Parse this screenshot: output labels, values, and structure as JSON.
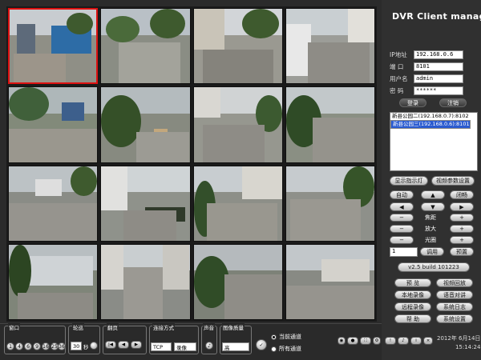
{
  "app": {
    "title": "DVR Client manager"
  },
  "login": {
    "ip_label": "IP地址",
    "ip_value": "192.168.0.6",
    "port_label": "端 口",
    "port_value": "8101",
    "user_label": "用户名",
    "user_value": "admin",
    "pass_label": "密 码",
    "pass_value": "******",
    "login_btn": "登录",
    "logout_btn": "注销"
  },
  "devices": [
    {
      "label": "新县公园二(192.168.0.7):8102",
      "selected": false
    },
    {
      "label": "新县公园三(192.168.0.6):8101",
      "selected": true
    }
  ],
  "buttons": {
    "show_osd": "显示指示灯",
    "video_params": "视频参数设置",
    "auto": "自动",
    "stop": "闭畅",
    "focus": "焦距",
    "zoom": "放大",
    "iris": "光圈",
    "call_preset": "调用",
    "set_preset": "预置",
    "preview": "预  览",
    "playback": "视频回放",
    "local_record": "本地录像",
    "voice_talk": "语音对讲",
    "remote_record": "远程录像",
    "system_log": "系统日志",
    "help": "帮  助",
    "system_settings": "系统设置"
  },
  "version": "v2.5 build 101223",
  "datetime": {
    "date": "2012年 6月14日",
    "time": "15:14:24"
  },
  "bottom": {
    "window_label": "窗口",
    "window_options": [
      "1",
      "4",
      "6",
      "9",
      "16",
      "25",
      "36"
    ],
    "poll_label": "轮巡",
    "poll_value": "30",
    "poll_unit": "秒",
    "page_label": "翻页",
    "conn_label": "连接方式",
    "conn_value": "TCP",
    "record_value": "录像",
    "sound_label": "声音",
    "quality_label": "图像质量",
    "quality_value": "高",
    "current_channel": "当前通道",
    "all_channels": "所有通道"
  },
  "colors": {
    "accent_selected": "#d11111",
    "device_highlight": "#2a5bd0"
  }
}
